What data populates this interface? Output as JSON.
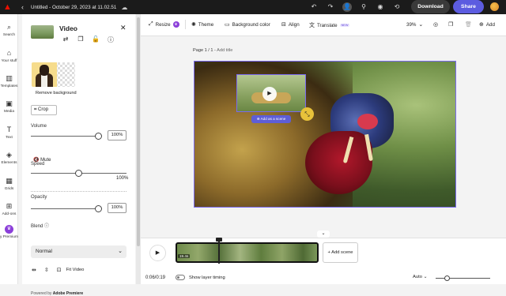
{
  "topbar": {
    "doc_title": "Untitled - October 29, 2023 at 11.02.51",
    "download_label": "Download",
    "share_label": "Share",
    "accent": "#5c5ce0"
  },
  "rail": {
    "items": [
      {
        "label": "Search",
        "icon": "search-icon"
      },
      {
        "label": "Your stuff",
        "icon": "home-icon"
      },
      {
        "label": "Templates",
        "icon": "templates-icon"
      },
      {
        "label": "Media",
        "icon": "media-icon"
      },
      {
        "label": "Text",
        "icon": "text-icon"
      },
      {
        "label": "Elements",
        "icon": "elements-icon"
      },
      {
        "label": "Grids",
        "icon": "grids-icon"
      },
      {
        "label": "Add-ons",
        "icon": "addons-icon"
      },
      {
        "label": "y Premium",
        "icon": "crown-icon"
      }
    ]
  },
  "panel": {
    "title": "Video",
    "remove_bg_label": "Remove background",
    "crop_label": "Crop",
    "volume_label": "Volume",
    "volume_value": "100%",
    "mute_label": "Mute",
    "speed_label": "Speed",
    "speed_value": "100%",
    "opacity_label": "Opacity",
    "opacity_value": "100%",
    "blend_label": "Blend",
    "blend_value": "Normal",
    "fit_label": "Fit Video",
    "powered_prefix": "Powered by ",
    "powered_brand": "Adobe Premiere"
  },
  "toolbar": {
    "resize_label": "Resize",
    "theme_label": "Theme",
    "bg_color_label": "Background color",
    "align_label": "Align",
    "translate_label": "Translate",
    "new_badge": "NEW",
    "zoom": "39%",
    "add_label": "Add"
  },
  "canvas": {
    "page_label": "Page 1 / 1 - ",
    "add_title": "Add title",
    "add_scene_pill": "Add as a scene"
  },
  "timeline": {
    "clip_duration": "19.4s",
    "add_scene_label": "+ Add scene",
    "time_readout": "0:06/0:19",
    "layer_timing_label": "Show layer timing",
    "auto_label": "Auto"
  }
}
